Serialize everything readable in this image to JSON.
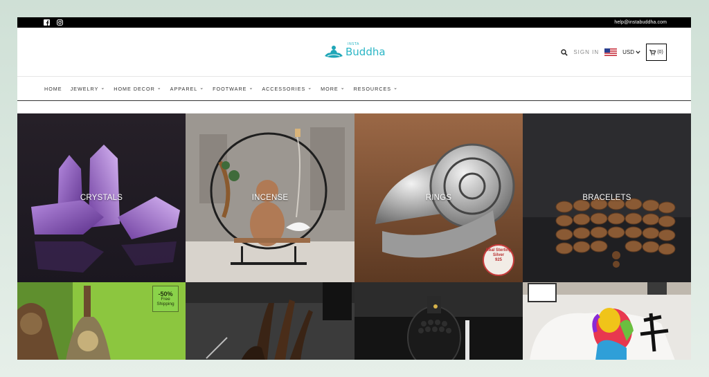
{
  "topbar": {
    "email": "help@instabuddha.com",
    "icons": [
      "facebook-icon",
      "instagram-icon"
    ]
  },
  "header": {
    "logo_small": "INSTA",
    "logo_main": "Buddha",
    "signin_label": "SIGN IN",
    "currency_label": "USD",
    "cart_count": "(0)"
  },
  "nav": {
    "items": [
      {
        "label": "HOME",
        "has_dropdown": false
      },
      {
        "label": "JEWELRY",
        "has_dropdown": true
      },
      {
        "label": "HOME DECOR",
        "has_dropdown": true
      },
      {
        "label": "APPAREL",
        "has_dropdown": true
      },
      {
        "label": "FOOTWARE",
        "has_dropdown": true
      },
      {
        "label": "ACCESSORIES",
        "has_dropdown": true
      },
      {
        "label": "MORE",
        "has_dropdown": true
      },
      {
        "label": "RESOURCES",
        "has_dropdown": true
      }
    ]
  },
  "tiles": {
    "row1": [
      {
        "label": "CRYSTALS"
      },
      {
        "label": "INCENSE"
      },
      {
        "label": "RINGS"
      },
      {
        "label": "BRACELETS"
      }
    ],
    "sale_badge": {
      "percent": "-50%",
      "line1": "Free",
      "line2": "Shipping"
    },
    "ring_stamp": {
      "text": "Real Sterling Silver",
      "number": "925"
    }
  },
  "colors": {
    "brand": "#2bb6c6",
    "topbar": "#000000"
  }
}
